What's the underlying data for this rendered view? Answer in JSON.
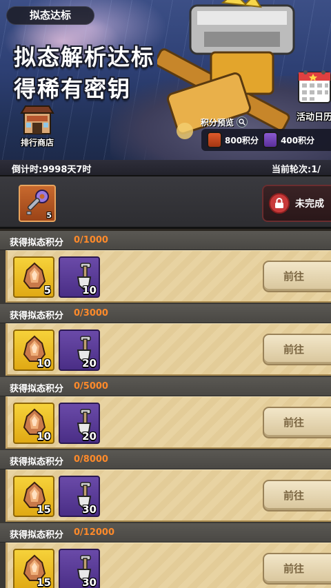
{
  "banner": {
    "title": "拟态达标",
    "headline_line1": "拟态解析达标",
    "headline_line2": "得稀有密钥",
    "shop_label": "排行商店",
    "calendar_label": "活动日历",
    "preview": {
      "title": "积分预览",
      "items": [
        {
          "label": "800积分",
          "color": "orange"
        },
        {
          "label": "400积分",
          "color": "purple"
        }
      ]
    }
  },
  "info": {
    "countdown": "倒计时:9998天7时",
    "round": "当前轮次:1/"
  },
  "key_reward": {
    "count": "5",
    "status": "未完成"
  },
  "tasks": [
    {
      "label": "获得拟态积分",
      "progress": "0/1000",
      "reward1": "5",
      "reward2": "10",
      "button": "前往"
    },
    {
      "label": "获得拟态积分",
      "progress": "0/3000",
      "reward1": "10",
      "reward2": "20",
      "button": "前往"
    },
    {
      "label": "获得拟态积分",
      "progress": "0/5000",
      "reward1": "10",
      "reward2": "20",
      "button": "前往"
    },
    {
      "label": "获得拟态积分",
      "progress": "0/8000",
      "reward1": "15",
      "reward2": "30",
      "button": "前往"
    },
    {
      "label": "获得拟态积分",
      "progress": "0/12000",
      "reward1": "15",
      "reward2": "30",
      "button": "前往"
    }
  ]
}
